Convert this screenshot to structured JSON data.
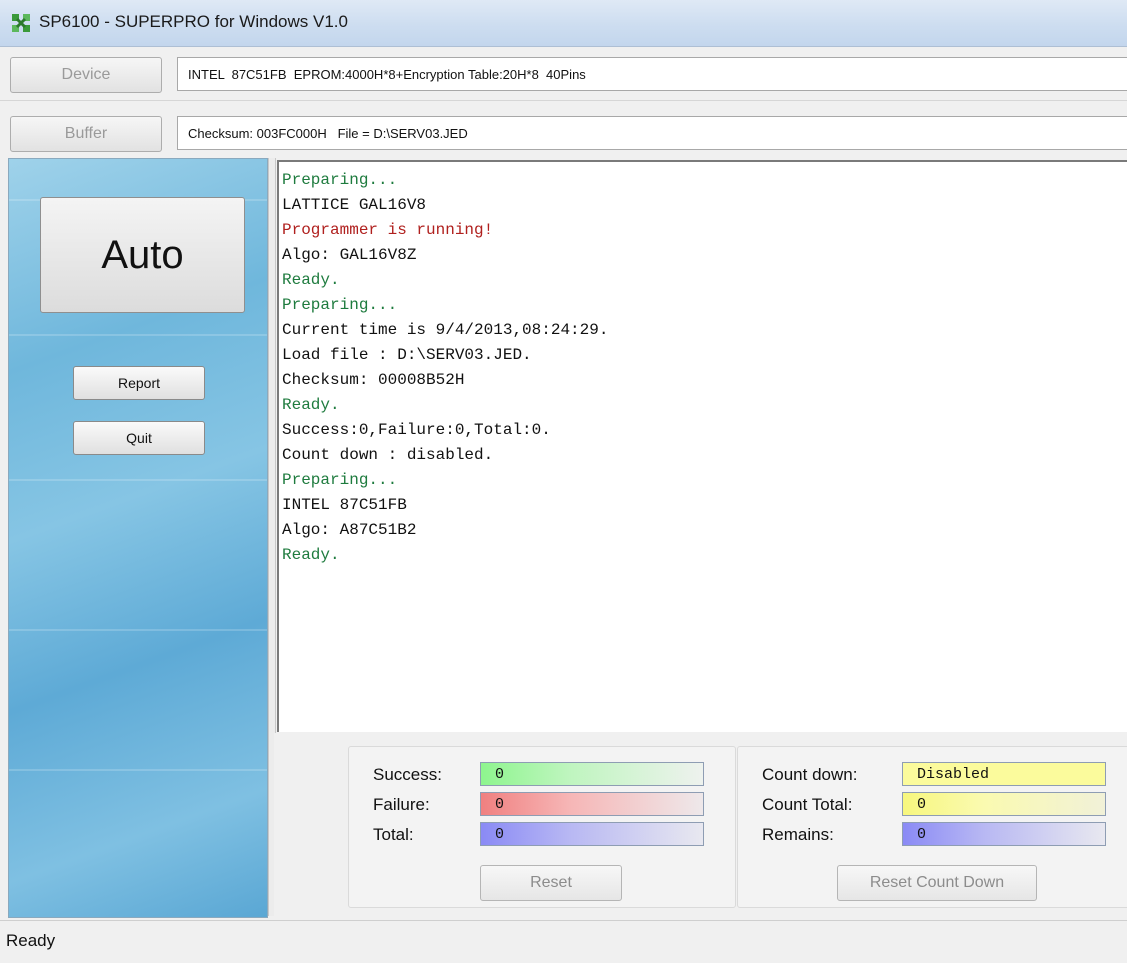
{
  "window": {
    "title": "SP6100 - SUPERPRO for Windows V1.0",
    "icon": "superpro-app-icon"
  },
  "device": {
    "button_label": "Device",
    "info": "INTEL  87C51FB  EPROM:4000H*8+Encryption Table:20H*8  40Pins"
  },
  "buffer": {
    "button_label": "Buffer",
    "info": "Checksum: 003FC000H   File = D:\\SERV03.JED"
  },
  "left_panel": {
    "auto_label": "Auto",
    "report_label": "Report",
    "quit_label": "Quit"
  },
  "log": {
    "lines": [
      {
        "text": "Preparing...",
        "color": "#1e7b3e"
      },
      {
        "text": "LATTICE GAL16V8",
        "color": "#111111"
      },
      {
        "text": "Programmer is running!",
        "color": "#b0201e"
      },
      {
        "text": "Algo: GAL16V8Z",
        "color": "#111111"
      },
      {
        "text": "Ready.",
        "color": "#1e7b3e"
      },
      {
        "text": "Preparing...",
        "color": "#1e7b3e"
      },
      {
        "text": "Current time is 9/4/2013,08:24:29.",
        "color": "#111111"
      },
      {
        "text": "Load file : D:\\SERV03.JED.",
        "color": "#111111"
      },
      {
        "text": "Checksum: 00008B52H",
        "color": "#111111"
      },
      {
        "text": "Ready.",
        "color": "#1e7b3e"
      },
      {
        "text": "Success:0,Failure:0,Total:0.",
        "color": "#111111"
      },
      {
        "text": "Count down : disabled.",
        "color": "#111111"
      },
      {
        "text": "Preparing...",
        "color": "#1e7b3e"
      },
      {
        "text": "INTEL 87C51FB",
        "color": "#111111"
      },
      {
        "text": "Algo: A87C51B2",
        "color": "#111111"
      },
      {
        "text": "Ready.",
        "color": "#1e7b3e"
      }
    ]
  },
  "stats": {
    "success_label": "Success:",
    "success_value": "0",
    "failure_label": "Failure:",
    "failure_value": "0",
    "total_label": "Total:",
    "total_value": "0",
    "reset_label": "Reset"
  },
  "countdown": {
    "countdown_label": "Count down:",
    "countdown_value": "Disabled",
    "count_total_label": "Count Total:",
    "count_total_value": "0",
    "remains_label": "Remains:",
    "remains_value": "0",
    "reset_countdown_label": "Reset Count Down"
  },
  "status_bar": {
    "text": "Ready"
  }
}
